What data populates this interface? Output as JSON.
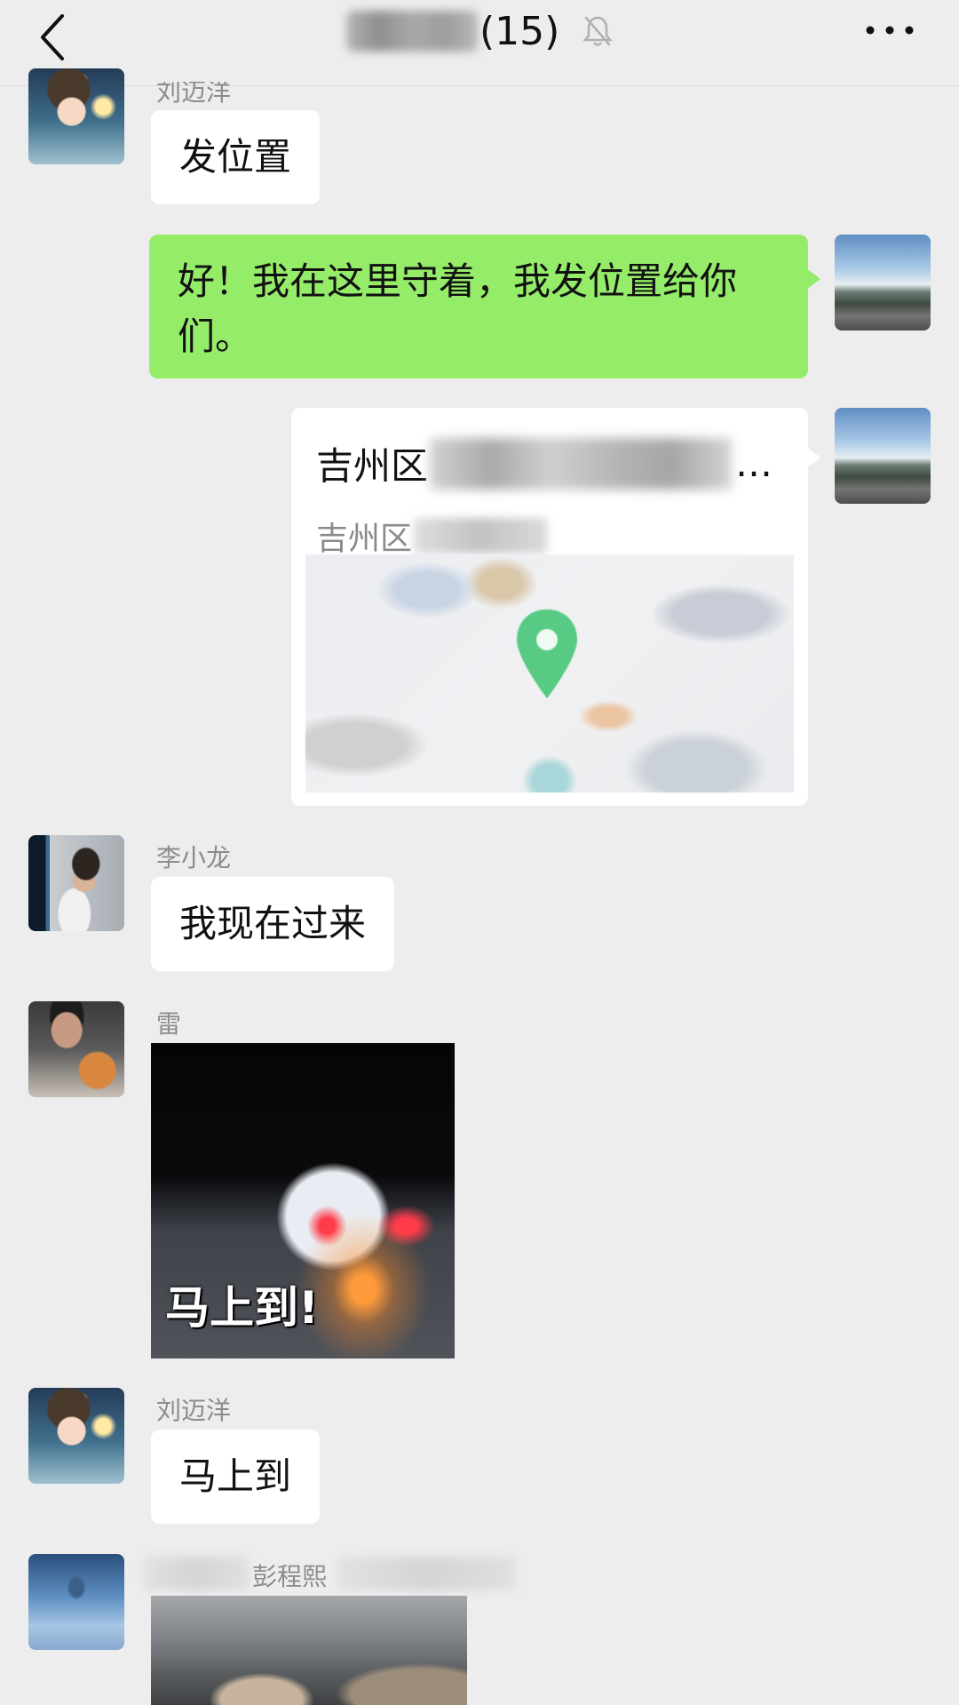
{
  "header": {
    "title_count": "(15)",
    "back_icon": "chevron-left-icon",
    "mute_icon": "bell-off-icon",
    "more_icon": "more-dots-icon"
  },
  "messages": [
    {
      "sender": "刘迈洋",
      "text": "发位置"
    },
    {
      "self": true,
      "text": "好！我在这里守着，我发位置给你们。"
    },
    {
      "self": true,
      "location": {
        "title": "吉州区",
        "title_ellipsis": "…",
        "subtitle": "吉州区"
      }
    },
    {
      "sender": "李小龙",
      "text": "我现在过来"
    },
    {
      "sender": "雷",
      "image_caption": "马上到!"
    },
    {
      "sender": "刘迈洋",
      "text": "马上到"
    },
    {
      "sender": "彭程熙"
    }
  ],
  "colors": {
    "background": "#ededed",
    "self_bubble": "#95ec69",
    "other_bubble": "#ffffff",
    "map_pin": "#3cc36e"
  }
}
